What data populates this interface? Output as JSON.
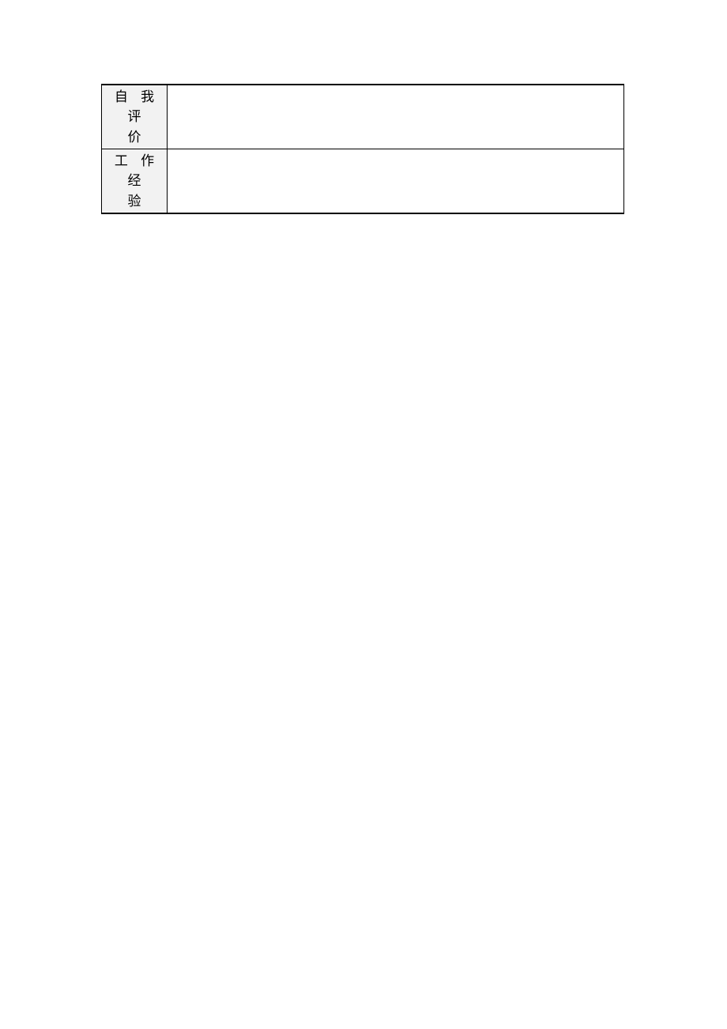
{
  "rows": [
    {
      "label_top": "自 我 评",
      "label_bottom": "价",
      "content": ""
    },
    {
      "label_top": "工 作 经",
      "label_bottom": "验",
      "content": ""
    }
  ]
}
